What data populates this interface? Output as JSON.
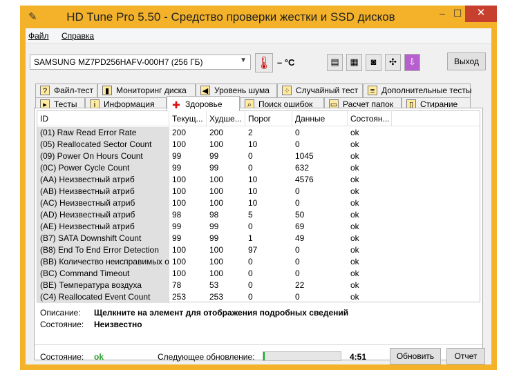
{
  "window": {
    "title": "HD Tune Pro 5.50 - Средство проверки жестки и SSD дисков",
    "min_glyph": "–",
    "max_glyph": "☐",
    "close_glyph": "✕"
  },
  "menu": [
    {
      "label": "Файл"
    },
    {
      "label": "Справка"
    }
  ],
  "toolbar": {
    "drive": "SAMSUNG MZ7PD256HAFV-000H7 (256 ГБ)",
    "temperature": "– °C",
    "exit_label": "Выход",
    "buttons": [
      {
        "icon": "copy-info-icon",
        "glyph": "▤"
      },
      {
        "icon": "copy-text-icon",
        "glyph": "▦"
      },
      {
        "icon": "camera-icon",
        "glyph": "◙"
      },
      {
        "icon": "options-icon",
        "glyph": "✣"
      },
      {
        "icon": "save-download-icon",
        "glyph": "⇩"
      }
    ]
  },
  "tabs_back": [
    {
      "label": "Файл-тест",
      "icon": "file-test-icon"
    },
    {
      "label": "Мониторинг диска",
      "icon": "disk-monitor-icon"
    },
    {
      "label": "Уровень шума",
      "icon": "speaker-icon"
    },
    {
      "label": "Случайный тест",
      "icon": "random-test-icon"
    },
    {
      "label": "Дополнительные тесты",
      "icon": "extra-tests-icon"
    }
  ],
  "tabs_front": [
    {
      "label": "Тесты",
      "icon": "benchmark-icon"
    },
    {
      "label": "Информация",
      "icon": "info-icon"
    },
    {
      "label": "Здоровье",
      "icon": "health-cross-icon"
    },
    {
      "label": "Поиск ошибок",
      "icon": "error-scan-icon"
    },
    {
      "label": "Расчет папок",
      "icon": "folder-usage-icon"
    },
    {
      "label": "Стирание",
      "icon": "erase-icon"
    }
  ],
  "active_tab": "Здоровье",
  "table": {
    "headers": [
      "ID",
      "Текущ...",
      "Худше...",
      "Порог",
      "Данные",
      "Состоян..."
    ],
    "rows": [
      [
        "(01) Raw Read Error Rate",
        "200",
        "200",
        "2",
        "0",
        "ok"
      ],
      [
        "(05) Reallocated Sector Count",
        "100",
        "100",
        "10",
        "0",
        "ok"
      ],
      [
        "(09) Power On Hours Count",
        "99",
        "99",
        "0",
        "1045",
        "ok"
      ],
      [
        "(0C) Power Cycle Count",
        "99",
        "99",
        "0",
        "632",
        "ok"
      ],
      [
        "(AA) Неизвестный атриб",
        "100",
        "100",
        "10",
        "4576",
        "ok"
      ],
      [
        "(AB) Неизвестный атриб",
        "100",
        "100",
        "10",
        "0",
        "ok"
      ],
      [
        "(AC) Неизвестный атриб",
        "100",
        "100",
        "10",
        "0",
        "ok"
      ],
      [
        "(AD) Неизвестный атриб",
        "98",
        "98",
        "5",
        "50",
        "ok"
      ],
      [
        "(AE) Неизвестный атриб",
        "99",
        "99",
        "0",
        "69",
        "ok"
      ],
      [
        "(B7) SATA Downshift Count",
        "99",
        "99",
        "1",
        "49",
        "ok"
      ],
      [
        "(B8) End To End Error Detection",
        "100",
        "100",
        "97",
        "0",
        "ok"
      ],
      [
        "(BB) Количество неисправимых о",
        "100",
        "100",
        "0",
        "0",
        "ok"
      ],
      [
        "(BC) Command Timeout",
        "100",
        "100",
        "0",
        "0",
        "ok"
      ],
      [
        "(BE) Температура воздуха",
        "78",
        "53",
        "0",
        "22",
        "ok"
      ],
      [
        "(C4) Reallocated Event Count",
        "253",
        "253",
        "0",
        "0",
        "ok"
      ]
    ]
  },
  "details": {
    "desc_label": "Описание:",
    "desc_value": "Щелкните на элемент для отображения подробных сведений",
    "state_label": "Состояние:",
    "state_value": "Неизвестно"
  },
  "status": {
    "state_label": "Состояние:",
    "state_value": "ok",
    "next_update_label": "Следующее обновление:",
    "progress_fraction": 0.02,
    "time_left": "4:51",
    "refresh_label": "Обновить",
    "report_label": "Отчет"
  },
  "colors": {
    "frame": "#f3b229",
    "close_button": "#c7402e",
    "ok_text": "#2a9d2a",
    "progress_fill": "#06b025"
  }
}
